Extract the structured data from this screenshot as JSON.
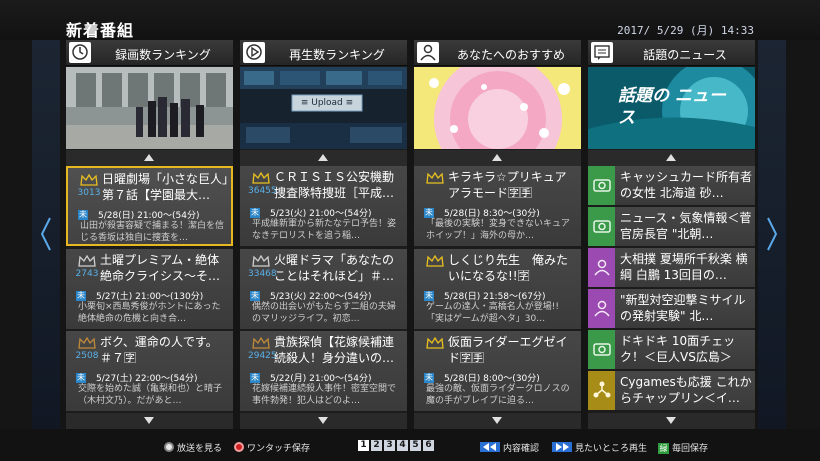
{
  "header": {
    "title": "新着番組",
    "datetime": "2017/ 5/29 (月) 14:33"
  },
  "columns": [
    {
      "title": "録画数ランキング",
      "icon": "clock-icon",
      "thumb_label": "",
      "cards": [
        {
          "rank": "3013",
          "title": "日曜劇場「小さな巨人」第７話【学園最大…",
          "badge": "未",
          "air": "5/28(日) 21:00～(54分)",
          "desc": "山田が殺害容疑で捕まる！潔白を信じる香坂は独自に捜査を…"
        },
        {
          "rank": "2743",
          "title": "土曜プレミアム・絶体絶命クライシス～そ…",
          "badge": "未",
          "air": "5/27(土) 21:00～(130分)",
          "desc": "小栗旬×西島秀俊がホントにあった絶体絶命の危機と向き合…"
        },
        {
          "rank": "2508",
          "title": "ボク、運命の人です。　＃７🈑",
          "badge": "未",
          "air": "5/27(土) 22:00～(54分)",
          "desc": "交際を始めた誠（亀梨和也）と晴子（木村文乃）。だがあと…"
        }
      ]
    },
    {
      "title": "再生数ランキング",
      "icon": "play-icon",
      "thumb_label": "≡ Upload ≡",
      "cards": [
        {
          "rank": "36455",
          "title": "ＣＲＩＳＩＳ公安機動捜査隊特捜班［平成…",
          "badge": "未",
          "air": "5/23(火) 21:00～(54分)",
          "desc": "平成維新軍から新たなテロ予告！姿なきテロリストを追う稲…"
        },
        {
          "rank": "33468",
          "title": "火曜ドラマ「あなたのことはそれほど」＃…",
          "badge": "未",
          "air": "5/23(火) 22:00～(54分)",
          "desc": "偶然の出会いがもたらす二組の夫婦のマリッジライフ。初恋…"
        },
        {
          "rank": "29425",
          "title": "貴族探偵【花嫁候補連続殺人！身分違いの…",
          "badge": "未",
          "air": "5/22(月) 21:00～(54分)",
          "desc": "花嫁候補連続殺人事件！密室空間で事件勃発！犯人はどのよ…"
        }
      ]
    },
    {
      "title": "あなたへのおすすめ",
      "icon": "person-icon",
      "thumb_label": "",
      "cards": [
        {
          "rank": "",
          "title": "キラキラ☆プリキュアアラモード🈑🈐",
          "badge": "未",
          "air": "5/28(日) 8:30～(30分)",
          "desc": "「最後の実験！変身できないキュアホイップ！」海外の母か…"
        },
        {
          "rank": "",
          "title": "しくじり先生　俺みたいになるな!!🈑",
          "badge": "未",
          "air": "5/28(日) 21:58～(67分)",
          "desc": "ゲームの達人・高橋名人が登場!!「実はゲームが超ヘタ」30…"
        },
        {
          "rank": "",
          "title": "仮面ライダーエグゼイド🈑🈐",
          "badge": "未",
          "air": "5/28(日) 8:00～(30分)",
          "desc": "最強の敵、仮面ライダークロノスの魔の手がブレイブに迫る…"
        }
      ]
    },
    {
      "title": "話題のニュース",
      "icon": "news-icon",
      "thumb_label": "話題の ニュース",
      "items": [
        {
          "icon": "camera-icon",
          "color": "#3a9a4a",
          "text": "キャッシュカード所有者の女性 北海道 砂…"
        },
        {
          "icon": "camera-icon",
          "color": "#3a9a4a",
          "text": "ニュース・気象情報＜菅官房長官 \"北朝…"
        },
        {
          "icon": "person-icon",
          "color": "#9a4ab0",
          "text": "大相撲 夏場所千秋楽 横綱 白鵬 13回目の…"
        },
        {
          "icon": "person-icon",
          "color": "#9a4ab0",
          "text": "\"新型対空迎撃ミサイルの発射実験\" 北…"
        },
        {
          "icon": "camera-icon",
          "color": "#3a9a4a",
          "text": "ドキドキ 10面チェック！＜巨人VS広島＞"
        },
        {
          "icon": "nodes-icon",
          "color": "#a88c18",
          "text": "Cygamesも応援 これからチャップリン＜イ…"
        }
      ]
    }
  ],
  "footer": {
    "watch_label": "放送を見る",
    "record_label": "ワンタッチ保存",
    "pages": [
      "1",
      "2",
      "3",
      "4",
      "5",
      "6"
    ],
    "active_page": "1",
    "rewind_label": "内容確認",
    "forward_label": "見たいところ再生",
    "green_key": "緑",
    "save_label": "毎回保存"
  },
  "colors": {
    "selection": "#e8b820",
    "rank_blue": "#58b0e8",
    "badge_blue": "#2a86c8",
    "key_blue": "#2a6fd4",
    "record_red": "#d02020",
    "green_key": "#2e9c3c"
  }
}
